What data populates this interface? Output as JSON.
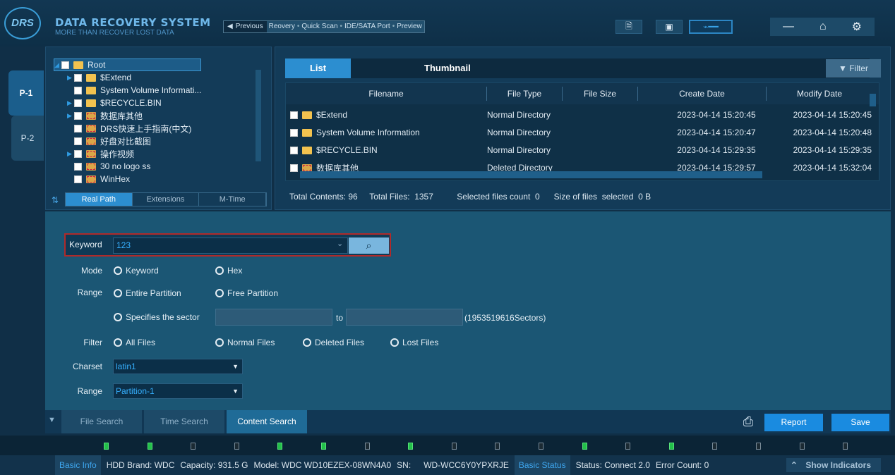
{
  "header": {
    "logo_text": "DRS",
    "title": "DATA RECOVERY SYSTEM",
    "subtitle": "MORE THAN RECOVER LOST DATA",
    "breadcrumb": {
      "prev_label": "Previous",
      "items": [
        "Reovery",
        "Quick Scan",
        "IDE/SATA Port",
        "Preview"
      ]
    }
  },
  "side_tabs": [
    "P-1",
    "P-2"
  ],
  "tree": {
    "items": [
      {
        "label": "Root",
        "expand": true,
        "selected": true
      },
      {
        "label": "$Extend",
        "expand": true
      },
      {
        "label": "System Volume Informati...",
        "expand": false
      },
      {
        "label": "$RECYCLE.BIN",
        "expand": true
      },
      {
        "label": "数据库其他",
        "expand": true
      },
      {
        "label": "DRS快速上手指南(中文)",
        "expand": false
      },
      {
        "label": "好盘对比截图",
        "expand": false
      },
      {
        "label": "操作视频",
        "expand": true
      },
      {
        "label": "30 no logo ss",
        "expand": false
      },
      {
        "label": "WinHex",
        "expand": false
      }
    ],
    "tabs": [
      "Real Path",
      "Extensions",
      "M-Time"
    ]
  },
  "list": {
    "tab_list": "List",
    "tab_thumbnail": "Thumbnail",
    "filter_label": "Filter",
    "columns": [
      "Filename",
      "File Type",
      "File Size",
      "Create Date",
      "Modify Date"
    ],
    "rows": [
      {
        "name": "$Extend",
        "type": "Normal Directory",
        "size": "",
        "created": "2023-04-14 15:20:45",
        "modified": "2023-04-14 15:20:45"
      },
      {
        "name": "System Volume Information",
        "type": "Normal Directory",
        "size": "",
        "created": "2023-04-14 15:20:47",
        "modified": "2023-04-14 15:20:48"
      },
      {
        "name": "$RECYCLE.BIN",
        "type": "Normal Directory",
        "size": "",
        "created": "2023-04-14 15:29:35",
        "modified": "2023-04-14 15:29:35"
      },
      {
        "name": "数据库其他",
        "type": "Deleted Directory",
        "size": "",
        "created": "2023-04-14 15:29:57",
        "modified": "2023-04-14 15:32:04"
      }
    ],
    "stats": {
      "total_contents": "Total Contents: 96",
      "total_files": "Total Files:  1357",
      "selected_count": "Selected files count  0",
      "size_selected": "Size of files  selected  0 B"
    }
  },
  "search": {
    "keyword_label": "Keyword",
    "keyword_value": "123",
    "mode_label": "Mode",
    "mode_keyword": "Keyword",
    "mode_hex": "Hex",
    "range_label": "Range",
    "entire_partition": "Entire Partition",
    "free_partition": "Free Partition",
    "specifies_sector": "Specifies the sector",
    "to_label": "to",
    "sector_total": "(1953519616Sectors)",
    "filter_label": "Filter",
    "all_files": "All Files",
    "normal_files": "Normal Files",
    "deleted_files": "Deleted Files",
    "lost_files": "Lost Files",
    "charset_label": "Charset",
    "charset_value": "latin1",
    "range2_label": "Range",
    "partition_value": "Partition-1"
  },
  "bottom_tabs": [
    "File Search",
    "Time Search",
    "Content Search"
  ],
  "buttons": {
    "report": "Report",
    "save": "Save"
  },
  "indicators": [
    true,
    true,
    false,
    false,
    true,
    true,
    false,
    true,
    false,
    false,
    false,
    true,
    false,
    true,
    false,
    false,
    false,
    false
  ],
  "status": {
    "basic_info": "Basic Info",
    "hdd_brand": "HDD Brand: WDC",
    "capacity": "Capacity: 931.5 G",
    "model": "Model: WDC WD10EZEX-08WN4A0",
    "sn_label": "SN:",
    "sn_value": "WD-WCC6Y0YPXRJE",
    "basic_status": "Basic Status",
    "status_text": "Status: Connect 2.0",
    "error_count": "Error Count: 0",
    "show_indicators": "Show Indicators"
  }
}
